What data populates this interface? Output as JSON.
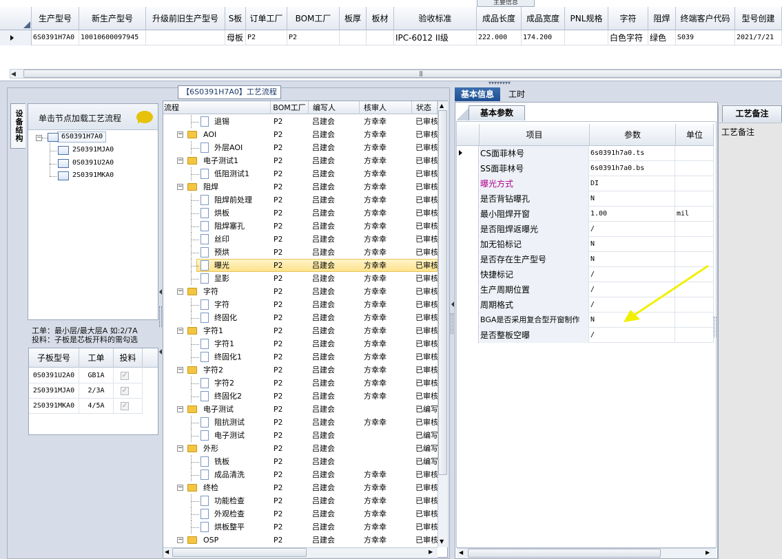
{
  "top_tab_stub": "主要信息",
  "top_grid": {
    "columns": [
      "生产型号",
      "新生产型号",
      "升级前旧生产型号",
      "S板",
      "订单工厂",
      "BOM工厂",
      "板厚",
      "板材",
      "验收标准",
      "成品长度",
      "成品宽度",
      "PNL规格",
      "字符",
      "阻焊",
      "终端客户代码",
      "型号创建"
    ],
    "row": [
      "6S0391H7A0",
      "10010600097945",
      "",
      "母板",
      "P2",
      "P2",
      "",
      "",
      "IPC-6012 II级",
      "222.000",
      "174.200",
      "",
      "白色字符",
      "绿色",
      "S039",
      "2021/7/21"
    ]
  },
  "left_panel": {
    "title": "【6S0391H7A0】工艺流程",
    "vertical_tab": "设备结构",
    "equip_hint": "单击节点加载工艺流程",
    "equip_tree": [
      "6S0391H7A0",
      "2S0391MJA0",
      "0S0391U2A0",
      "2S0391MKA0"
    ],
    "note_line1": "工单：最小层/最大层A 如:2/7A",
    "note_line2": "投料：子板是芯板开料的需勾选",
    "sub_grid": {
      "headers": [
        "子板型号",
        "工单",
        "投料"
      ],
      "rows": [
        {
          "model": "0S0391U2A0",
          "order": "GB1A",
          "fed": true
        },
        {
          "model": "2S0391MJA0",
          "order": "2/3A",
          "fed": true
        },
        {
          "model": "2S0391MKA0",
          "order": "4/5A",
          "fed": true
        }
      ]
    }
  },
  "process_grid": {
    "headers": [
      "流程",
      "BOM工厂",
      "编写人",
      "核审人",
      "状态"
    ],
    "rows": [
      {
        "name": "退锡",
        "type": "doc",
        "level": 2,
        "bom": "P2",
        "writer": "吕建会",
        "reviewer": "方幸幸",
        "status": "已审核"
      },
      {
        "name": "AOI",
        "type": "folder",
        "level": 1,
        "bom": "P2",
        "writer": "吕建会",
        "reviewer": "方幸幸",
        "status": "已审核"
      },
      {
        "name": "外层AOI",
        "type": "doc",
        "level": 2,
        "bom": "P2",
        "writer": "吕建会",
        "reviewer": "方幸幸",
        "status": "已审核"
      },
      {
        "name": "电子测试1",
        "type": "folder",
        "level": 1,
        "bom": "P2",
        "writer": "吕建会",
        "reviewer": "方幸幸",
        "status": "已审核"
      },
      {
        "name": "低阻测试1",
        "type": "doc",
        "level": 2,
        "bom": "P2",
        "writer": "吕建会",
        "reviewer": "方幸幸",
        "status": "已审核"
      },
      {
        "name": "阻焊",
        "type": "folder",
        "level": 1,
        "bom": "P2",
        "writer": "吕建会",
        "reviewer": "方幸幸",
        "status": "已审核"
      },
      {
        "name": "阻焊前处理",
        "type": "doc",
        "level": 2,
        "bom": "P2",
        "writer": "吕建会",
        "reviewer": "方幸幸",
        "status": "已审核"
      },
      {
        "name": "烘板",
        "type": "doc",
        "level": 2,
        "bom": "P2",
        "writer": "吕建会",
        "reviewer": "方幸幸",
        "status": "已审核"
      },
      {
        "name": "阻焊塞孔",
        "type": "doc",
        "level": 2,
        "bom": "P2",
        "writer": "吕建会",
        "reviewer": "方幸幸",
        "status": "已审核"
      },
      {
        "name": "丝印",
        "type": "doc",
        "level": 2,
        "bom": "P2",
        "writer": "吕建会",
        "reviewer": "方幸幸",
        "status": "已审核"
      },
      {
        "name": "预烘",
        "type": "doc",
        "level": 2,
        "bom": "P2",
        "writer": "吕建会",
        "reviewer": "方幸幸",
        "status": "已审核"
      },
      {
        "name": "曝光",
        "type": "doc",
        "level": 2,
        "bom": "P2",
        "writer": "吕建会",
        "reviewer": "方幸幸",
        "status": "已审核",
        "selected": true
      },
      {
        "name": "显影",
        "type": "doc",
        "level": 2,
        "bom": "P2",
        "writer": "吕建会",
        "reviewer": "方幸幸",
        "status": "已审核"
      },
      {
        "name": "字符",
        "type": "folder",
        "level": 1,
        "bom": "P2",
        "writer": "吕建会",
        "reviewer": "方幸幸",
        "status": "已审核"
      },
      {
        "name": "字符",
        "type": "doc",
        "level": 2,
        "bom": "P2",
        "writer": "吕建会",
        "reviewer": "方幸幸",
        "status": "已审核"
      },
      {
        "name": "终固化",
        "type": "doc",
        "level": 2,
        "bom": "P2",
        "writer": "吕建会",
        "reviewer": "方幸幸",
        "status": "已审核"
      },
      {
        "name": "字符1",
        "type": "folder",
        "level": 1,
        "bom": "P2",
        "writer": "吕建会",
        "reviewer": "方幸幸",
        "status": "已审核"
      },
      {
        "name": "字符1",
        "type": "doc",
        "level": 2,
        "bom": "P2",
        "writer": "吕建会",
        "reviewer": "方幸幸",
        "status": "已审核"
      },
      {
        "name": "终固化1",
        "type": "doc",
        "level": 2,
        "bom": "P2",
        "writer": "吕建会",
        "reviewer": "方幸幸",
        "status": "已审核"
      },
      {
        "name": "字符2",
        "type": "folder",
        "level": 1,
        "bom": "P2",
        "writer": "吕建会",
        "reviewer": "方幸幸",
        "status": "已审核"
      },
      {
        "name": "字符2",
        "type": "doc",
        "level": 2,
        "bom": "P2",
        "writer": "吕建会",
        "reviewer": "方幸幸",
        "status": "已审核"
      },
      {
        "name": "终固化2",
        "type": "doc",
        "level": 2,
        "bom": "P2",
        "writer": "吕建会",
        "reviewer": "方幸幸",
        "status": "已审核"
      },
      {
        "name": "电子测试",
        "type": "folder",
        "level": 1,
        "bom": "P2",
        "writer": "吕建会",
        "reviewer": "",
        "status": "已编写"
      },
      {
        "name": "阻抗测试",
        "type": "doc",
        "level": 2,
        "bom": "P2",
        "writer": "吕建会",
        "reviewer": "方幸幸",
        "status": "已审核"
      },
      {
        "name": "电子测试",
        "type": "doc",
        "level": 2,
        "bom": "P2",
        "writer": "吕建会",
        "reviewer": "",
        "status": "已编写"
      },
      {
        "name": "外形",
        "type": "folder",
        "level": 1,
        "bom": "P2",
        "writer": "吕建会",
        "reviewer": "",
        "status": "已编写"
      },
      {
        "name": "铣板",
        "type": "doc",
        "level": 2,
        "bom": "P2",
        "writer": "吕建会",
        "reviewer": "",
        "status": "已编写"
      },
      {
        "name": "成品清洗",
        "type": "doc",
        "level": 2,
        "bom": "P2",
        "writer": "吕建会",
        "reviewer": "方幸幸",
        "status": "已审核"
      },
      {
        "name": "终检",
        "type": "folder",
        "level": 1,
        "bom": "P2",
        "writer": "吕建会",
        "reviewer": "方幸幸",
        "status": "已审核"
      },
      {
        "name": "功能检查",
        "type": "doc",
        "level": 2,
        "bom": "P2",
        "writer": "吕建会",
        "reviewer": "方幸幸",
        "status": "已审核"
      },
      {
        "name": "外观检查",
        "type": "doc",
        "level": 2,
        "bom": "P2",
        "writer": "吕建会",
        "reviewer": "方幸幸",
        "status": "已审核"
      },
      {
        "name": "烘板整平",
        "type": "doc",
        "level": 2,
        "bom": "P2",
        "writer": "吕建会",
        "reviewer": "方幸幸",
        "status": "已审核"
      },
      {
        "name": "OSP",
        "type": "folder",
        "level": 1,
        "bom": "P2",
        "writer": "吕建会",
        "reviewer": "方幸幸",
        "status": "已审核"
      }
    ]
  },
  "right_panel": {
    "tabs": [
      "基本信息",
      "工时"
    ],
    "sub_tab": "基本参数",
    "headers": [
      "项目",
      "参数",
      "单位"
    ],
    "rows": [
      {
        "item": "CS面菲林号",
        "value": "6s0391h7a0.ts",
        "unit": ""
      },
      {
        "item": "SS面菲林号",
        "value": "6s0391h7a0.bs",
        "unit": ""
      },
      {
        "item": "曝光方式",
        "value": "DI",
        "unit": "",
        "highlight": true
      },
      {
        "item": "是否背钻曝孔",
        "value": "N",
        "unit": ""
      },
      {
        "item": "最小阻焊开窗",
        "value": "1.00",
        "unit": "mil"
      },
      {
        "item": "是否阻焊返曝光",
        "value": "/",
        "unit": ""
      },
      {
        "item": "加无铅标记",
        "value": "N",
        "unit": ""
      },
      {
        "item": "是否存在生产型号",
        "value": "N",
        "unit": ""
      },
      {
        "item": "快捷标记",
        "value": "/",
        "unit": ""
      },
      {
        "item": "生产周期位置",
        "value": "/",
        "unit": ""
      },
      {
        "item": "周期格式",
        "value": "/",
        "unit": ""
      },
      {
        "item": "BGA是否采用复合型开窗制作",
        "value": "N",
        "unit": ""
      },
      {
        "item": "是否整板空曝",
        "value": "/",
        "unit": ""
      }
    ],
    "highlight_color": "#b0008c"
  },
  "remark_panel": {
    "tab": "工艺备注",
    "label": "工艺备注"
  },
  "colors": {
    "arrow": "#f0f000",
    "selected_row": "#fde38c",
    "tab_active": "#1f4f91"
  }
}
